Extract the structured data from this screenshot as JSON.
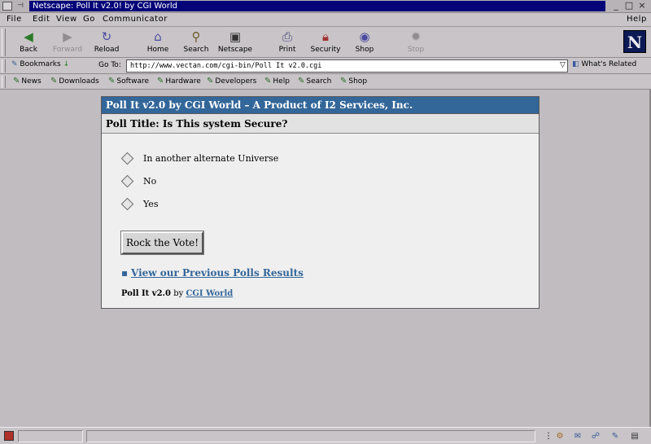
{
  "window": {
    "title": "Netscape: Poll It v2.0! by CGI World",
    "minimize": "_",
    "maximize": "□",
    "close": "×"
  },
  "menu": {
    "file": "File",
    "edit": "Edit",
    "view": "View",
    "go": "Go",
    "communicator": "Communicator",
    "help": "Help"
  },
  "toolbar": {
    "back": "Back",
    "forward": "Forward",
    "reload": "Reload",
    "home": "Home",
    "search": "Search",
    "netscape": "Netscape",
    "print": "Print",
    "security": "Security",
    "shop": "Shop",
    "stop": "Stop"
  },
  "location": {
    "bookmarks": "Bookmarks",
    "goto": "Go To:",
    "url": "http://www.vectan.com/cgi-bin/Poll It v2.0.cgi",
    "related": "What's Related"
  },
  "personal": [
    "News",
    "Downloads",
    "Software",
    "Hardware",
    "Developers",
    "Help",
    "Search",
    "Shop"
  ],
  "poll": {
    "header": "Poll It v2.0 by CGI World – A Product of I2 Services, Inc.",
    "title": "Poll Title: Is This system Secure?",
    "options": [
      "In another alternate Universe",
      "No",
      "Yes"
    ],
    "vote_button": "Rock the Vote!",
    "previous_bullet": "▪",
    "previous_link": "View our Previous Polls Results",
    "credit_product": "Poll It v2.0",
    "credit_by": "by",
    "credit_link": "CGI World"
  },
  "icons": {
    "back": "arrow-left-icon",
    "forward": "arrow-right-icon",
    "reload": "reload-icon",
    "home": "home-icon",
    "search": "search-icon",
    "netscape": "netscape-icon",
    "print": "print-icon",
    "security": "lock-icon",
    "shop": "shop-icon",
    "stop": "stop-icon"
  },
  "colors": {
    "poll_header": "#336699",
    "title_bar": "#050579",
    "link": "#336699"
  }
}
